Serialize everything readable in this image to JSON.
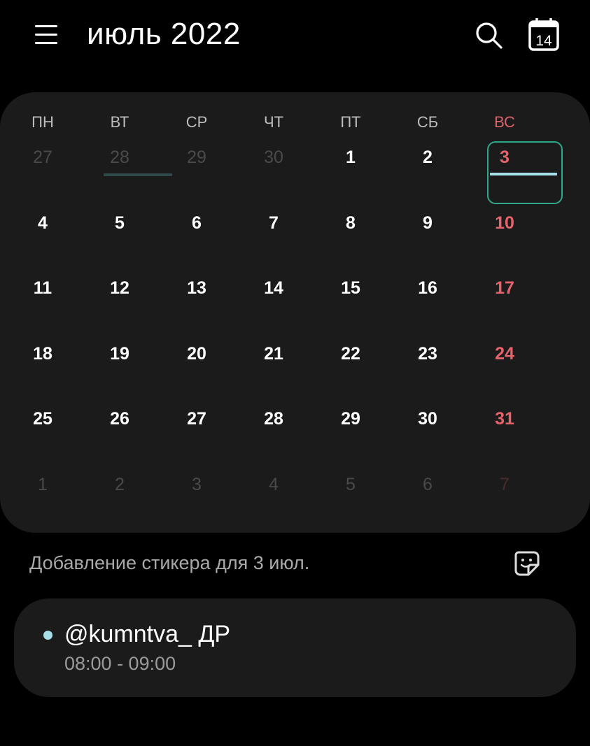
{
  "header": {
    "title": "июль 2022",
    "today_icon_day": "14"
  },
  "calendar": {
    "weekdays": [
      "ПН",
      "ВТ",
      "СР",
      "ЧТ",
      "ПТ",
      "СБ",
      "ВС"
    ],
    "weeks": [
      [
        "27",
        "28",
        "29",
        "30",
        "1",
        "2",
        "3"
      ],
      [
        "4",
        "5",
        "6",
        "7",
        "8",
        "9",
        "10"
      ],
      [
        "11",
        "12",
        "13",
        "14",
        "15",
        "16",
        "17"
      ],
      [
        "18",
        "19",
        "20",
        "21",
        "22",
        "23",
        "24"
      ],
      [
        "25",
        "26",
        "27",
        "28",
        "29",
        "30",
        "31"
      ],
      [
        "1",
        "2",
        "3",
        "4",
        "5",
        "6",
        "7"
      ]
    ],
    "selected_date": "3",
    "colors": {
      "sunday": "#e5636a",
      "selected_border": "#2fa98a",
      "event": "#a7dfe6",
      "event_dim": "#2f4a48"
    }
  },
  "sticker": {
    "text": "Добавление стикера для 3 июл.",
    "icon": "sticker-smile-icon"
  },
  "event": {
    "title": "@kumntva_ ДР",
    "time": "08:00 - 09:00",
    "color": "#a7dfe6"
  }
}
